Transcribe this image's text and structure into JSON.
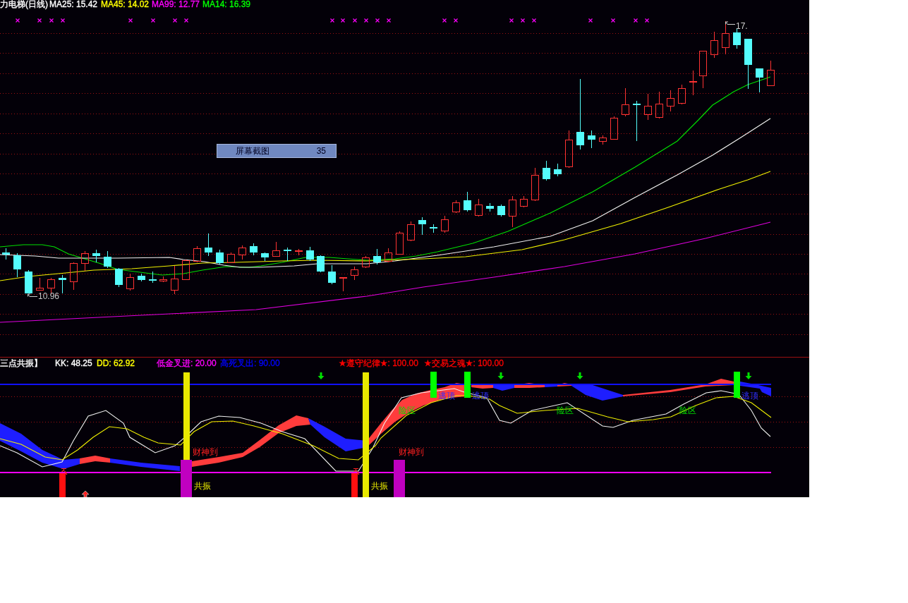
{
  "price_header": {
    "title": "力电梯(日线)",
    "averages": [
      {
        "text": "MA25: 15.42",
        "color": "#ffffff"
      },
      {
        "text": "MA45: 14.02",
        "color": "#ffff00"
      },
      {
        "text": "MA99: 12.77",
        "color": "#ff00ff"
      },
      {
        "text": "MA14: 16.39",
        "color": "#00ff00"
      }
    ]
  },
  "price_chart": {
    "low_label": "10.96",
    "high_label": "17."
  },
  "screenshot_label": {
    "caption": "屏幕截图",
    "count": "35"
  },
  "indicator_header": {
    "title": "三点共振】",
    "values": [
      {
        "text": "KK: 48.25",
        "color": "#ffffff"
      },
      {
        "text": "DD: 62.92",
        "color": "#ffff00"
      },
      {
        "text": "低金叉进: 20.00",
        "color": "#ff00ff"
      },
      {
        "text": "高死叉出: 90.00",
        "color": "#0000ff"
      },
      {
        "text": "★遵守纪律★: 100.00",
        "color": "#ff0000"
      },
      {
        "text": "★交易之魂★: 100.00",
        "color": "#ff0000"
      }
    ]
  },
  "indicator_chart": {
    "top_signals": [
      "逃顶",
      "逃顶",
      "逃顶"
    ],
    "zone_labels": [
      "险区",
      "险区",
      "险区"
    ],
    "wealth_labels": [
      "财神到",
      "财神到"
    ],
    "resonance_labels": [
      "共振",
      "共振"
    ]
  }
}
